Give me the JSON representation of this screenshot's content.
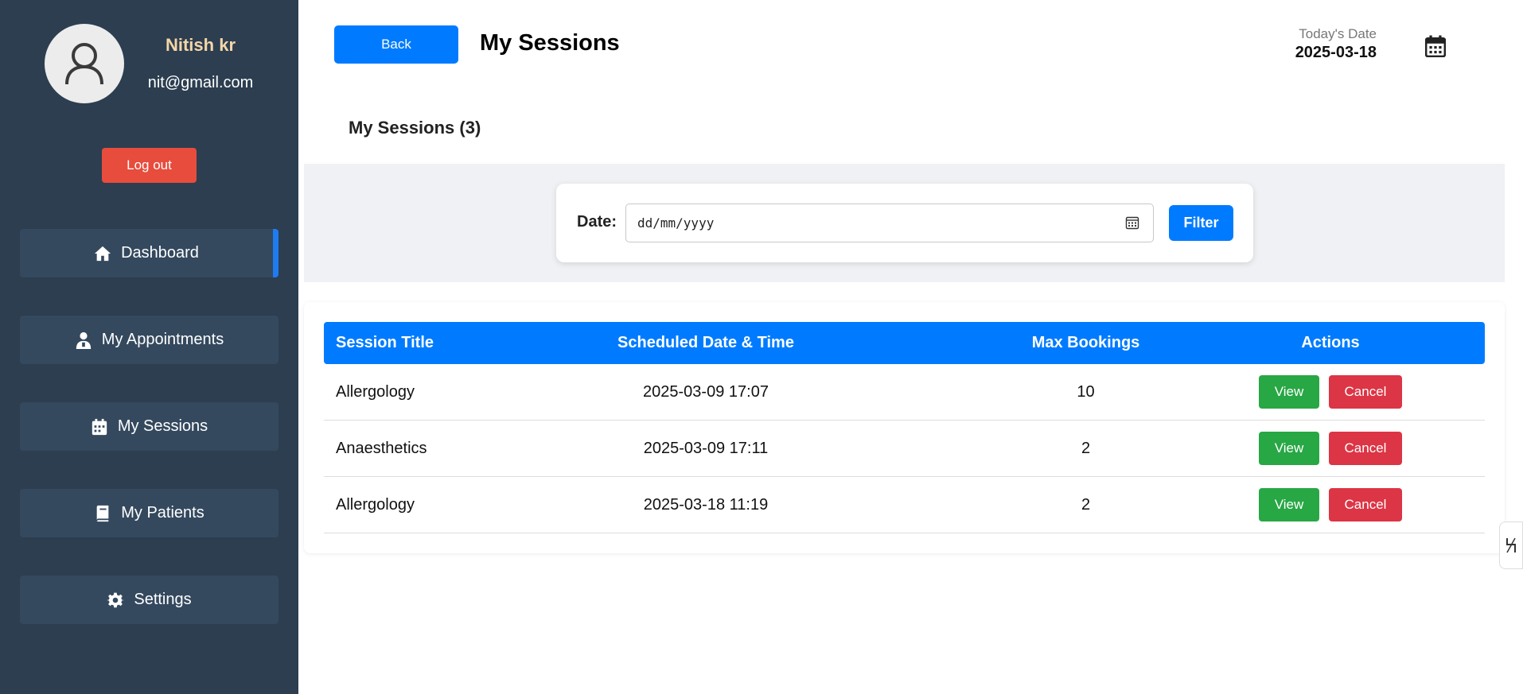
{
  "sidebar": {
    "user_name": "Nitish kr",
    "user_email": "nit@gmail.com",
    "logout_label": "Log out",
    "items": [
      {
        "label": "Dashboard",
        "icon": "home-icon"
      },
      {
        "label": "My Appointments",
        "icon": "doctor-icon"
      },
      {
        "label": "My Sessions",
        "icon": "calendar-icon"
      },
      {
        "label": "My Patients",
        "icon": "book-icon"
      },
      {
        "label": "Settings",
        "icon": "gear-icon"
      }
    ]
  },
  "header": {
    "back_label": "Back",
    "title": "My Sessions",
    "date_label": "Today's Date",
    "date_value": "2025-03-18"
  },
  "main": {
    "count_title": "My Sessions (3)",
    "filter": {
      "label": "Date:",
      "placeholder": "dd/mm/yyyy",
      "button_label": "Filter"
    },
    "table": {
      "columns": [
        "Session Title",
        "Scheduled Date & Time",
        "Max Bookings",
        "Actions"
      ],
      "rows": [
        {
          "title": "Allergology",
          "datetime": "2025-03-09 17:07",
          "max": "10",
          "view": "View",
          "cancel": "Cancel"
        },
        {
          "title": "Anaesthetics",
          "datetime": "2025-03-09 17:11",
          "max": "2",
          "view": "View",
          "cancel": "Cancel"
        },
        {
          "title": "Allergology",
          "datetime": "2025-03-18 11:19",
          "max": "2",
          "view": "View",
          "cancel": "Cancel"
        }
      ]
    }
  },
  "colors": {
    "sidebar_bg": "#2c3e50",
    "nav_item_bg": "#34495e",
    "accent": "#007bff",
    "logout": "#e74c3c",
    "view": "#28a745",
    "cancel": "#dc3545"
  }
}
